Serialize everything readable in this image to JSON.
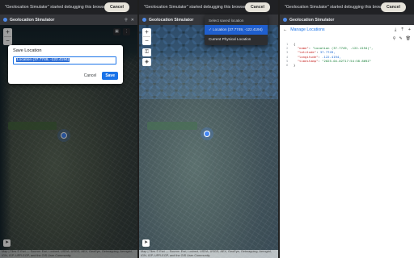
{
  "panels": [
    {
      "infobar": {
        "message": "\"Geolocation Simulator\" started debugging this browser",
        "cancel": "Cancel"
      },
      "header": {
        "title": "Geolocation Simulator"
      },
      "map": {
        "footer": "Map | Tiles © Esri — Source: Esri, i-cubed, USDA, USGS, AEX, GeoEye, Getmapping, Aerogrid, IGN, IGP, UPR-EGP, and the GIS User Community"
      },
      "dialog": {
        "title": "Save Location",
        "input_value": "Location (37.7749, -122.4194)",
        "cancel": "Cancel",
        "save": "Save"
      }
    },
    {
      "infobar": {
        "message": "\"Geolocation Simulator\" started debugging this browser",
        "cancel": "Cancel"
      },
      "header": {
        "title": "Geolocation Simulator"
      },
      "map": {
        "footer": "Map | Tiles © Esri — Source: Esri, i-cubed, USDA, USGS, AEX, GeoEye, Getmapping, Aerogrid, IGN, IGP, UPR-EGP, and the GIS User Community"
      },
      "dropdown": {
        "header": "Select saved location",
        "selected": "✓ Location (37.7749, -122.4194)",
        "current": "Current Physical Location"
      }
    },
    {
      "infobar": {
        "message": "\"Geolocation Simulator\" started debugging this browser",
        "cancel": "Cancel"
      },
      "header": {
        "title": "Geolocation Simulator"
      },
      "manage": {
        "title": "Manage Locations"
      },
      "json_lines": {
        "l1": "{",
        "l2k": "\"name\"",
        "l2v": "\"Location (37.7749, -122.4194)\",",
        "l3k": "\"latitude\"",
        "l3v": "37.7749,",
        "l4k": "\"longitude\"",
        "l4v": "-122.4194,",
        "l5k": "\"timestamp\"",
        "l5v": "\"2025-04-02T17:54:58.869Z\"",
        "l6": "}"
      }
    }
  ]
}
